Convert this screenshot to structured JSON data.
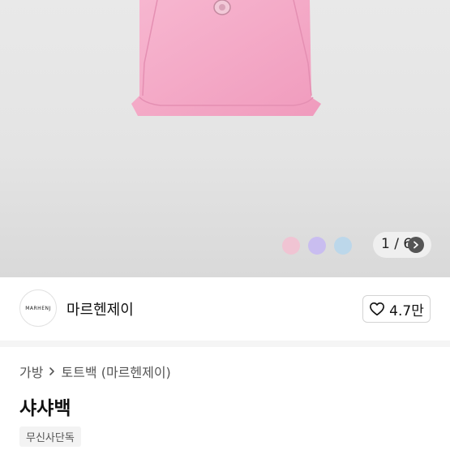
{
  "hero": {
    "image_description": "pink leather tote bag",
    "swatches": [
      {
        "name": "pink",
        "color": "#f0c4d3"
      },
      {
        "name": "lavender",
        "color": "#c9bdf0"
      },
      {
        "name": "light-blue",
        "color": "#bcd7ea"
      }
    ],
    "image_counter": "1 / 6",
    "bag_color": "#f3a9c7"
  },
  "brand": {
    "logo_text": "MARHENJ",
    "name": "마르헨제이",
    "like_count": "4.7만"
  },
  "breadcrumb": {
    "category": "가방",
    "subcategory": "토트백 (마르헨제이)"
  },
  "product": {
    "title": "샤샤백",
    "badge": "무신사단독"
  }
}
